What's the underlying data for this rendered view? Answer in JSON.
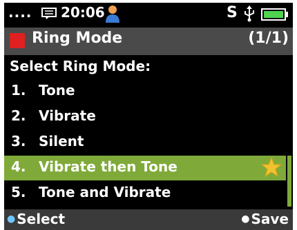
{
  "status_bar": {
    "signal_dots": "....",
    "time": "20:06",
    "s_indicator": "S"
  },
  "title_bar": {
    "title": "Ring Mode",
    "page_count": "(1/1)"
  },
  "prompt": "Select Ring Mode:",
  "items": [
    {
      "number": "1.",
      "label": "Tone"
    },
    {
      "number": "2.",
      "label": "Vibrate"
    },
    {
      "number": "3.",
      "label": "Silent"
    },
    {
      "number": "4.",
      "label": "Vibrate then Tone"
    },
    {
      "number": "5.",
      "label": "Tone and Vibrate"
    }
  ],
  "selected_index": 3,
  "softkeys": {
    "left": "Select",
    "right": "Save"
  },
  "colors": {
    "highlight": "#7faa3a",
    "title_bar": "#4a4a4a",
    "title_square": "#e02020",
    "star": "#f2c22e",
    "battery": "#4fd24f"
  },
  "icons": [
    "message-icon",
    "person-icon",
    "usb-icon",
    "battery-icon",
    "star-icon"
  ]
}
